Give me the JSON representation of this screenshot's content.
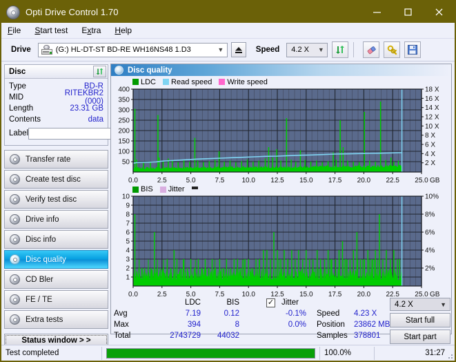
{
  "window": {
    "title": "Opti Drive Control 1.70",
    "icon": "disc-icon",
    "minimize": "–",
    "maximize": "□",
    "close": "✕"
  },
  "menu": {
    "items": [
      "File",
      "Start test",
      "Extra",
      "Help"
    ]
  },
  "toolbar": {
    "drive_label": "Drive",
    "drive_value": "(G:)  HL-DT-ST BD-RE  WH16NS48 1.D3",
    "eject_icon": "eject-icon",
    "speed_label": "Speed",
    "speed_value": "4.2 X",
    "refresh_icon": "refresh-icon",
    "erase_icon": "eraser-icon",
    "key_icon": "key-icon",
    "save_icon": "save-icon"
  },
  "disc_panel": {
    "title": "Disc",
    "refresh_icon": "refresh-icon",
    "rows": [
      {
        "key": "Type",
        "value": "BD-R"
      },
      {
        "key": "MID",
        "value": "RITEKBR2 (000)"
      },
      {
        "key": "Length",
        "value": "23.31 GB"
      },
      {
        "key": "Contents",
        "value": "data"
      }
    ],
    "label_key": "Label",
    "label_value": "",
    "label_button_icon": "disc-icon"
  },
  "nav": {
    "items": [
      {
        "label": "Transfer rate",
        "active": false
      },
      {
        "label": "Create test disc",
        "active": false
      },
      {
        "label": "Verify test disc",
        "active": false
      },
      {
        "label": "Drive info",
        "active": false
      },
      {
        "label": "Disc info",
        "active": false
      },
      {
        "label": "Disc quality",
        "active": true
      },
      {
        "label": "CD Bler",
        "active": false
      },
      {
        "label": "FE / TE",
        "active": false
      },
      {
        "label": "Extra tests",
        "active": false
      }
    ],
    "status_window": "Status window > >"
  },
  "content": {
    "title": "Disc quality",
    "title_icon": "disc-quality-icon"
  },
  "chart_data": [
    {
      "type": "area",
      "name": "ldc-chart",
      "title": "",
      "xlabel": "GB",
      "ylabel": "",
      "xlim": [
        0,
        25
      ],
      "ylim": [
        0,
        400
      ],
      "y2lim": [
        0,
        18
      ],
      "y2label": "X",
      "xticks": [
        "0.0",
        "2.5",
        "5.0",
        "7.5",
        "10.0",
        "12.5",
        "15.0",
        "17.5",
        "20.0",
        "22.5",
        "25.0"
      ],
      "xtick_suffix": "GB",
      "yticks": [
        400,
        350,
        300,
        250,
        200,
        150,
        100,
        50
      ],
      "y2ticks": [
        "18 X",
        "16 X",
        "14 X",
        "12 X",
        "10 X",
        "8 X",
        "6 X",
        "4 X",
        "2 X"
      ],
      "grid": true,
      "legend_position": "top-left",
      "series": [
        {
          "name": "LDC",
          "color": "#00cc00",
          "type": "area"
        },
        {
          "name": "Read speed",
          "color": "#7fd4f2",
          "type": "line"
        },
        {
          "name": "Write speed",
          "color": "#ff66cc",
          "type": "line"
        }
      ],
      "ldc_baseline": 22,
      "ldc_spikes": [
        [
          0.15,
          305
        ],
        [
          0.3,
          60
        ],
        [
          0.9,
          45
        ],
        [
          1.5,
          50
        ],
        [
          2.15,
          275
        ],
        [
          2.25,
          70
        ],
        [
          2.6,
          52
        ],
        [
          3.05,
          65
        ],
        [
          3.4,
          58
        ],
        [
          3.9,
          48
        ],
        [
          4.4,
          60
        ],
        [
          4.9,
          50
        ],
        [
          5.35,
          165
        ],
        [
          5.6,
          55
        ],
        [
          6.1,
          48
        ],
        [
          6.6,
          52
        ],
        [
          7.1,
          58
        ],
        [
          7.45,
          100
        ],
        [
          7.9,
          50
        ],
        [
          8.4,
          55
        ],
        [
          8.9,
          48
        ],
        [
          9.4,
          52
        ],
        [
          9.9,
          60
        ],
        [
          10.4,
          50
        ],
        [
          10.9,
          55
        ],
        [
          11.45,
          65
        ],
        [
          11.75,
          120
        ],
        [
          12.1,
          70
        ],
        [
          12.45,
          110
        ],
        [
          12.8,
          55
        ],
        [
          13.3,
          260
        ],
        [
          13.7,
          60
        ],
        [
          14.1,
          50
        ],
        [
          14.5,
          105
        ],
        [
          14.9,
          58
        ],
        [
          15.4,
          50
        ],
        [
          15.9,
          55
        ],
        [
          16.4,
          48
        ],
        [
          16.9,
          52
        ],
        [
          17.35,
          95
        ],
        [
          17.6,
          60
        ],
        [
          17.95,
          250
        ],
        [
          18.2,
          120
        ],
        [
          18.6,
          55
        ],
        [
          19.1,
          50
        ],
        [
          19.6,
          48
        ],
        [
          20.05,
          290
        ],
        [
          20.5,
          55
        ],
        [
          21.0,
          50
        ],
        [
          21.45,
          340
        ],
        [
          21.9,
          58
        ],
        [
          22.35,
          70
        ],
        [
          22.6,
          50
        ],
        [
          23.0,
          55
        ]
      ],
      "read_speed_points": [
        [
          0.0,
          1.9
        ],
        [
          0.3,
          2.05
        ],
        [
          1.0,
          2.1
        ],
        [
          2.0,
          2.2
        ],
        [
          2.5,
          2.35
        ],
        [
          3.5,
          2.5
        ],
        [
          4.5,
          2.65
        ],
        [
          5.5,
          2.8
        ],
        [
          6.5,
          2.9
        ],
        [
          7.5,
          3.0
        ],
        [
          8.5,
          3.1
        ],
        [
          9.5,
          3.2
        ],
        [
          10.5,
          3.3
        ],
        [
          11.5,
          3.4
        ],
        [
          12.5,
          3.45
        ],
        [
          13.5,
          3.55
        ],
        [
          14.5,
          3.65
        ],
        [
          15.5,
          3.7
        ],
        [
          16.5,
          3.8
        ],
        [
          17.5,
          3.9
        ],
        [
          18.5,
          3.95
        ],
        [
          19.5,
          4.0
        ],
        [
          20.5,
          4.05
        ],
        [
          21.5,
          4.1
        ],
        [
          22.5,
          4.15
        ],
        [
          23.3,
          4.2
        ]
      ],
      "read_end_marker_x": 23.3,
      "data_end_x": 23.31
    },
    {
      "type": "area",
      "name": "bis-jitter-chart",
      "title": "",
      "xlabel": "GB",
      "ylabel": "",
      "xlim": [
        0,
        25
      ],
      "ylim": [
        0,
        10
      ],
      "y2lim": [
        0,
        10
      ],
      "y2label": "%",
      "xticks": [
        "0.0",
        "2.5",
        "5.0",
        "7.5",
        "10.0",
        "12.5",
        "15.0",
        "17.5",
        "20.0",
        "22.5",
        "25.0"
      ],
      "xtick_suffix": "GB",
      "yticks": [
        10,
        9,
        8,
        7,
        6,
        5,
        4,
        3,
        2,
        1
      ],
      "y2ticks": [
        "10%",
        "8%",
        "6%",
        "4%",
        "2%"
      ],
      "grid": true,
      "legend_position": "top-left",
      "series": [
        {
          "name": "BIS",
          "color": "#00cc00",
          "type": "area"
        },
        {
          "name": "Jitter",
          "color": "#d9aee0",
          "type": "line"
        }
      ],
      "bis_baseline": 1.35,
      "bis_spikes": [
        [
          0.15,
          8
        ],
        [
          0.5,
          2
        ],
        [
          0.75,
          2
        ],
        [
          1.0,
          2
        ],
        [
          1.3,
          2
        ],
        [
          1.55,
          2
        ],
        [
          1.85,
          6
        ],
        [
          2.1,
          2
        ],
        [
          2.35,
          2
        ],
        [
          2.6,
          2
        ],
        [
          2.95,
          3
        ],
        [
          3.25,
          2
        ],
        [
          3.55,
          4
        ],
        [
          3.8,
          3
        ],
        [
          4.1,
          2
        ],
        [
          4.4,
          3
        ],
        [
          4.7,
          2
        ],
        [
          5.0,
          3
        ],
        [
          5.3,
          2
        ],
        [
          5.65,
          3
        ],
        [
          5.95,
          2
        ],
        [
          6.25,
          3
        ],
        [
          6.55,
          2
        ],
        [
          6.85,
          3
        ],
        [
          7.15,
          2
        ],
        [
          7.5,
          3
        ],
        [
          7.8,
          2
        ],
        [
          8.1,
          3
        ],
        [
          8.45,
          2
        ],
        [
          8.75,
          3
        ],
        [
          9.05,
          3
        ],
        [
          9.35,
          2
        ],
        [
          9.7,
          3
        ],
        [
          10.0,
          3
        ],
        [
          10.3,
          2
        ],
        [
          10.65,
          3
        ],
        [
          10.95,
          3
        ],
        [
          11.3,
          4
        ],
        [
          11.6,
          4
        ],
        [
          11.9,
          3
        ],
        [
          12.2,
          6
        ],
        [
          12.5,
          4
        ],
        [
          12.8,
          3
        ],
        [
          13.1,
          4
        ],
        [
          13.4,
          3
        ],
        [
          13.75,
          4
        ],
        [
          14.05,
          3
        ],
        [
          14.35,
          4
        ],
        [
          14.7,
          3
        ],
        [
          15.0,
          4
        ],
        [
          15.3,
          3
        ],
        [
          15.6,
          3
        ],
        [
          15.95,
          4
        ],
        [
          16.25,
          3
        ],
        [
          16.6,
          3
        ],
        [
          16.9,
          4
        ],
        [
          17.2,
          3
        ],
        [
          17.55,
          3
        ],
        [
          17.85,
          4
        ],
        [
          18.15,
          5
        ],
        [
          18.45,
          3
        ],
        [
          18.8,
          3
        ],
        [
          19.1,
          4
        ],
        [
          19.4,
          6
        ],
        [
          19.7,
          3
        ],
        [
          20.05,
          3
        ],
        [
          20.35,
          4
        ],
        [
          20.7,
          3
        ],
        [
          21.0,
          4
        ],
        [
          21.35,
          8
        ],
        [
          21.65,
          3
        ],
        [
          21.95,
          4
        ],
        [
          22.3,
          3
        ],
        [
          22.6,
          4
        ],
        [
          22.9,
          3
        ],
        [
          23.1,
          3
        ]
      ],
      "jitter_end_marker_x": 23.3,
      "data_end_x": 23.31
    }
  ],
  "stats": {
    "headers": {
      "ldc": "LDC",
      "bis": "BIS",
      "jitter": "Jitter"
    },
    "rows": [
      {
        "label": "Avg",
        "ldc": "7.19",
        "bis": "0.12",
        "jitter": "-0.1%"
      },
      {
        "label": "Max",
        "ldc": "394",
        "bis": "8",
        "jitter": "0.0%"
      },
      {
        "label": "Total",
        "ldc": "2743729",
        "bis": "44032",
        "jitter": ""
      }
    ],
    "jitter_checked": true,
    "jitter_check_glyph": "✓",
    "speed_label": "Speed",
    "speed_value": "4.23 X",
    "position_label": "Position",
    "position_value": "23862 MB",
    "samples_label": "Samples",
    "samples_value": "378801",
    "speed_select": "4.2 X",
    "start_full": "Start full",
    "start_part": "Start part"
  },
  "statusbar": {
    "message": "Test completed",
    "progress_pct": 100.0,
    "progress_text": "100.0%",
    "elapsed": "31:27"
  },
  "colors": {
    "titlebar": "#6b6108",
    "accent": "#0a8ed6",
    "plot_bg": "#5a6a8c",
    "grid": "#3c4356",
    "ldc_green": "#00cc00",
    "read_speed": "#7fd4f2",
    "write_speed": "#ff66cc",
    "jitter": "#d9aee0",
    "value_blue": "#2222cc",
    "progress_green": "#09a009"
  }
}
